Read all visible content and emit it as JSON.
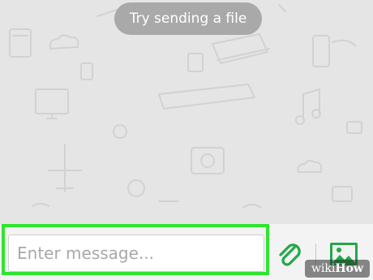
{
  "toast": {
    "text": "Try sending a file"
  },
  "composer": {
    "placeholder": "Enter message...",
    "attach_icon": "paperclip-icon",
    "image_icon": "image-icon"
  },
  "colors": {
    "highlight": "#2ee62e",
    "accent_green": "#22a84a",
    "toast_bg": "#a9a9a9"
  },
  "watermark": {
    "part1": "wiki",
    "part2": "How"
  }
}
